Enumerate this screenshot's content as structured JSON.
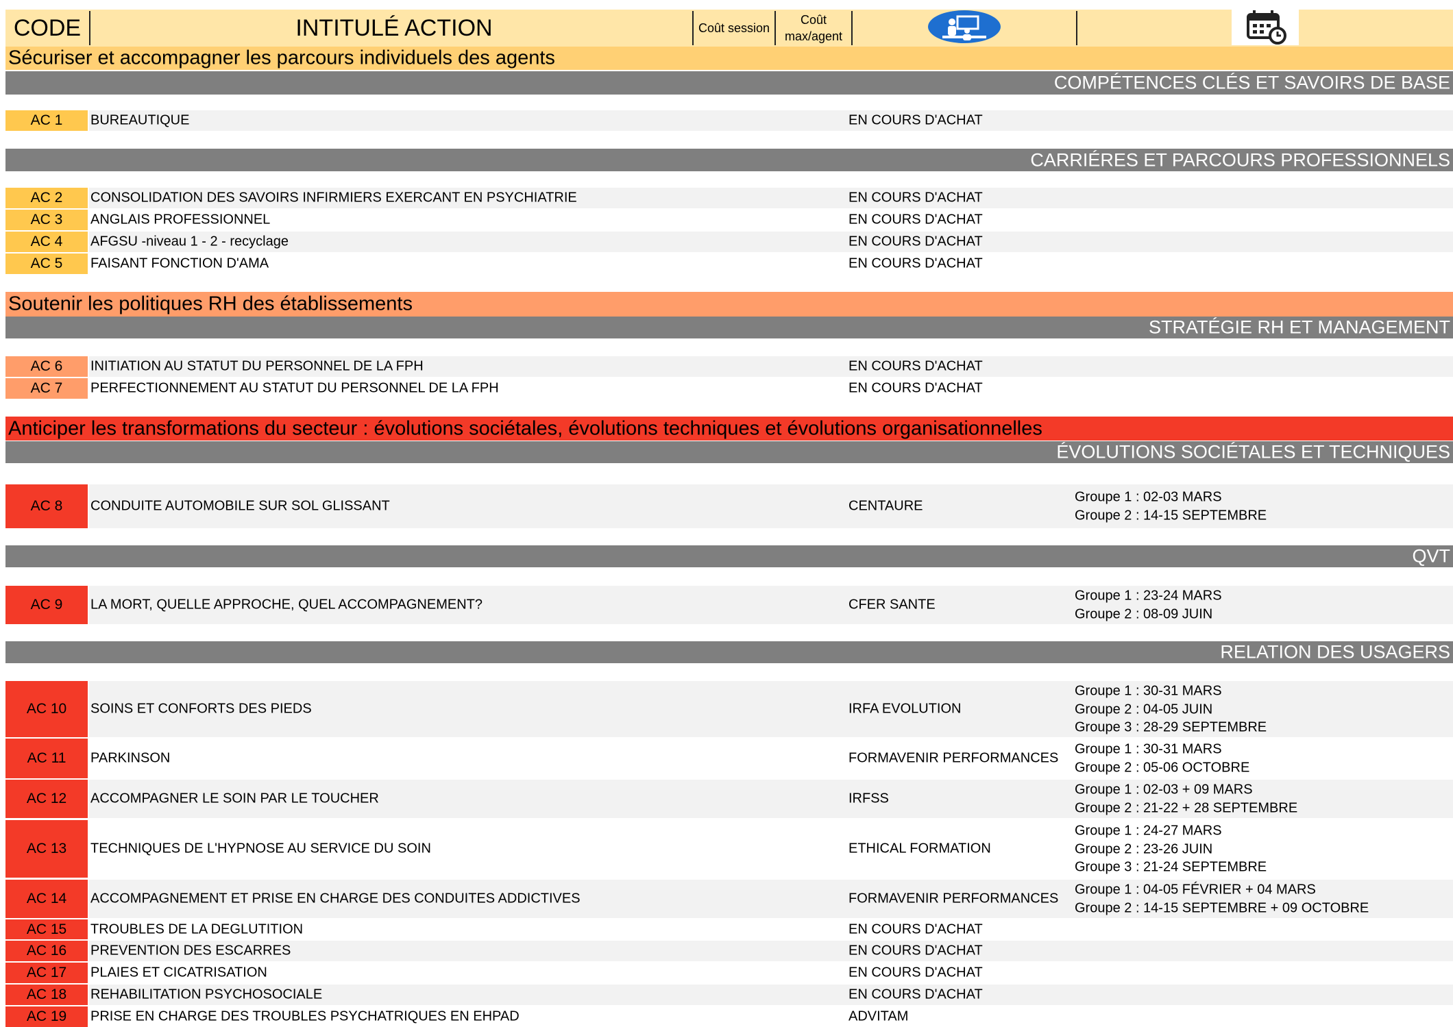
{
  "header": {
    "code": "CODE",
    "title": "INTITULÉ ACTION",
    "cost_session": "Coût session",
    "cost_max_line1": "Coût",
    "cost_max_line2": "max/agent",
    "mode_icon": "training-session-icon",
    "calendar_icon": "calendar-clock-icon"
  },
  "colors": {
    "axis1": "#ffd074",
    "axis2": "#ff9d6a",
    "axis3": "#f33a28",
    "theme": "#7f7f7f"
  },
  "axes": [
    "Sécuriser et accompagner les parcours individuels des agents",
    "Soutenir les politiques RH des établissements",
    "Anticiper les transformations du secteur : évolutions sociétales, évolutions techniques et évolutions organisationnelles"
  ],
  "themes": [
    "COMPÉTENCES CLÉS ET SAVOIRS DE BASE",
    "CARRIÉRES ET PARCOURS PROFESSIONNELS",
    "STRATÉGIE RH ET MANAGEMENT",
    "ÉVOLUTIONS SOCIÉTALES ET TECHNIQUES",
    "QVT",
    "RELATION DES USAGERS"
  ],
  "actions": [
    {
      "code": "AC 1",
      "title": "BUREAUTIQUE",
      "provider": "EN COURS D'ACHAT",
      "dates": []
    },
    {
      "code": "AC 2",
      "title": "CONSOLIDATION DES SAVOIRS INFIRMIERS EXERCANT EN PSYCHIATRIE",
      "provider": "EN COURS D'ACHAT",
      "dates": []
    },
    {
      "code": "AC 3",
      "title": "ANGLAIS PROFESSIONNEL",
      "provider": "EN COURS D'ACHAT",
      "dates": []
    },
    {
      "code": "AC 4",
      "title": "AFGSU -niveau 1 - 2 - recyclage",
      "provider": "EN COURS D'ACHAT",
      "dates": []
    },
    {
      "code": "AC 5",
      "title": "FAISANT FONCTION D'AMA",
      "provider": "EN COURS D'ACHAT",
      "dates": []
    },
    {
      "code": "AC 6",
      "title": "INITIATION AU STATUT DU PERSONNEL DE LA FPH",
      "provider": "EN COURS D'ACHAT",
      "dates": []
    },
    {
      "code": "AC 7",
      "title": "PERFECTIONNEMENT AU STATUT DU PERSONNEL DE LA FPH",
      "provider": "EN COURS D'ACHAT",
      "dates": []
    },
    {
      "code": "AC 8",
      "title": "CONDUITE AUTOMOBILE SUR SOL GLISSANT",
      "provider": "CENTAURE",
      "dates": [
        "Groupe 1 : 02-03 MARS",
        "Groupe 2 : 14-15 SEPTEMBRE"
      ]
    },
    {
      "code": "AC 9",
      "title": "LA MORT, QUELLE APPROCHE, QUEL ACCOMPAGNEMENT?",
      "provider": "CFER SANTE",
      "dates": [
        "Groupe 1 : 23-24 MARS",
        "Groupe 2 : 08-09 JUIN"
      ]
    },
    {
      "code": "AC 10",
      "title": "SOINS ET CONFORTS DES PIEDS",
      "provider": "IRFA EVOLUTION",
      "dates": [
        "Groupe 1 : 30-31 MARS",
        "Groupe 2 : 04-05 JUIN",
        "Groupe 3 : 28-29 SEPTEMBRE"
      ]
    },
    {
      "code": "AC 11",
      "title": "PARKINSON",
      "provider": "FORMAVENIR PERFORMANCES",
      "dates": [
        "Groupe 1 : 30-31 MARS",
        "Groupe 2 : 05-06 OCTOBRE"
      ]
    },
    {
      "code": "AC 12",
      "title": "ACCOMPAGNER LE SOIN PAR LE TOUCHER",
      "provider": "IRFSS",
      "dates": [
        "Groupe 1 : 02-03 + 09 MARS",
        "Groupe 2 : 21-22 + 28 SEPTEMBRE"
      ]
    },
    {
      "code": "AC 13",
      "title": "TECHNIQUES DE L'HYPNOSE AU SERVICE DU SOIN",
      "provider": "ETHICAL FORMATION",
      "dates": [
        "Groupe 1 : 24-27 MARS",
        "Groupe 2 : 23-26 JUIN",
        "Groupe 3 : 21-24 SEPTEMBRE"
      ]
    },
    {
      "code": "AC 14",
      "title": "ACCOMPAGNEMENT ET PRISE EN CHARGE DES CONDUITES ADDICTIVES",
      "provider": "FORMAVENIR PERFORMANCES",
      "dates": [
        "Groupe 1 : 04-05 FÉVRIER + 04 MARS",
        "Groupe 2 : 14-15 SEPTEMBRE + 09 OCTOBRE"
      ]
    },
    {
      "code": "AC 15",
      "title": "TROUBLES DE LA DEGLUTITION",
      "provider": "EN COURS D'ACHAT",
      "dates": []
    },
    {
      "code": "AC 16",
      "title": "PREVENTION DES ESCARRES",
      "provider": "EN COURS D'ACHAT",
      "dates": []
    },
    {
      "code": "AC 17",
      "title": "PLAIES ET CICATRISATION",
      "provider": "EN COURS D'ACHAT",
      "dates": []
    },
    {
      "code": "AC 18",
      "title": "REHABILITATION PSYCHOSOCIALE",
      "provider": "EN COURS D'ACHAT",
      "dates": []
    },
    {
      "code": "AC 19",
      "title": "PRISE EN CHARGE DES TROUBLES PSYCHATRIQUES EN EHPAD",
      "provider": "ADVITAM",
      "dates": []
    }
  ]
}
